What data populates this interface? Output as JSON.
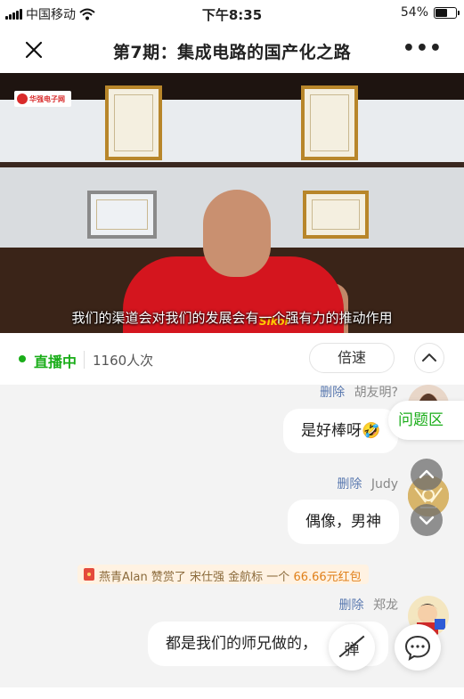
{
  "status_bar": {
    "carrier": "中国移动",
    "time": "下午8:35",
    "battery": "54%",
    "battery_level": 0.54,
    "icons": [
      "signal-icon",
      "wifi-icon",
      "battery-icon"
    ]
  },
  "nav": {
    "title": "第7期：集成电路的国产化之路",
    "close_icon": "close-icon",
    "more_label": "•••"
  },
  "video": {
    "caption": "我们的渠道会对我们的发展会有一个强有力的推动作用",
    "logo_text": "华强电子网",
    "shirt_brand": "Sikor"
  },
  "live": {
    "status": "直播中",
    "viewers": "1160人次",
    "speed_label": "倍速",
    "accent": "#1aad19"
  },
  "chat": {
    "delete_label": "删除",
    "messages": [
      {
        "author": "胡友明?",
        "text": "是好棒呀",
        "emoji": "🤣"
      },
      {
        "author": "Judy",
        "text": "偶像，男神"
      },
      {
        "author": "郑龙",
        "text": "都是我们的师兄做的，"
      }
    ],
    "reward": {
      "sender": "燕青Alan",
      "verb": "赞赏了",
      "recipient": "宋仕强 金航标",
      "middle": "一个",
      "amount": "66.66元红包"
    }
  },
  "overlay": {
    "question_tab": "问题区",
    "barrage_label": "弹",
    "comment_icon": "comment-icon"
  }
}
